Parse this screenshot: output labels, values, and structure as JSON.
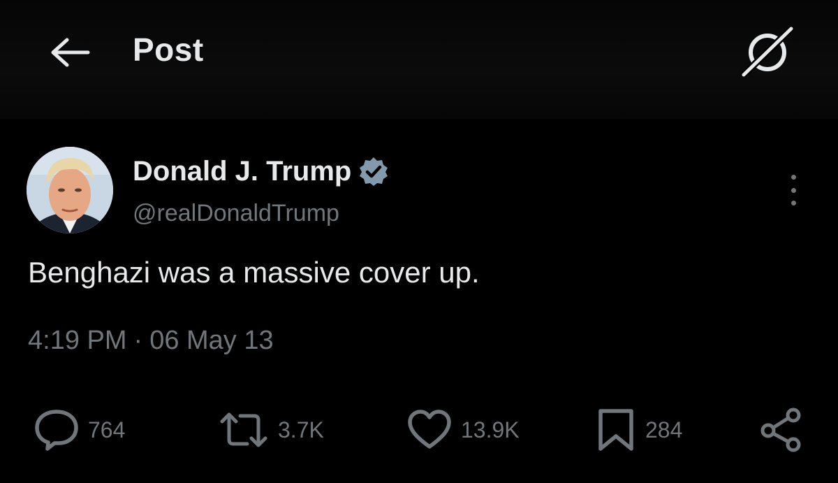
{
  "header": {
    "title": "Post",
    "back_icon": "arrow-left-icon",
    "grok_icon": "grok-icon"
  },
  "post": {
    "author": {
      "name": "Donald J. Trump",
      "handle": "@realDonaldTrump",
      "verified": true
    },
    "text": "Benghazi was a massive cover up.",
    "time": "4:19 PM",
    "separator": "·",
    "date": "06 May 13",
    "stats": {
      "replies": "764",
      "reposts": "3.7K",
      "likes": "13.9K",
      "bookmarks": "284"
    }
  },
  "colors": {
    "background": "#000000",
    "text_primary": "#e7e9ea",
    "text_secondary": "#71767b",
    "verified_badge": "#829aab"
  }
}
